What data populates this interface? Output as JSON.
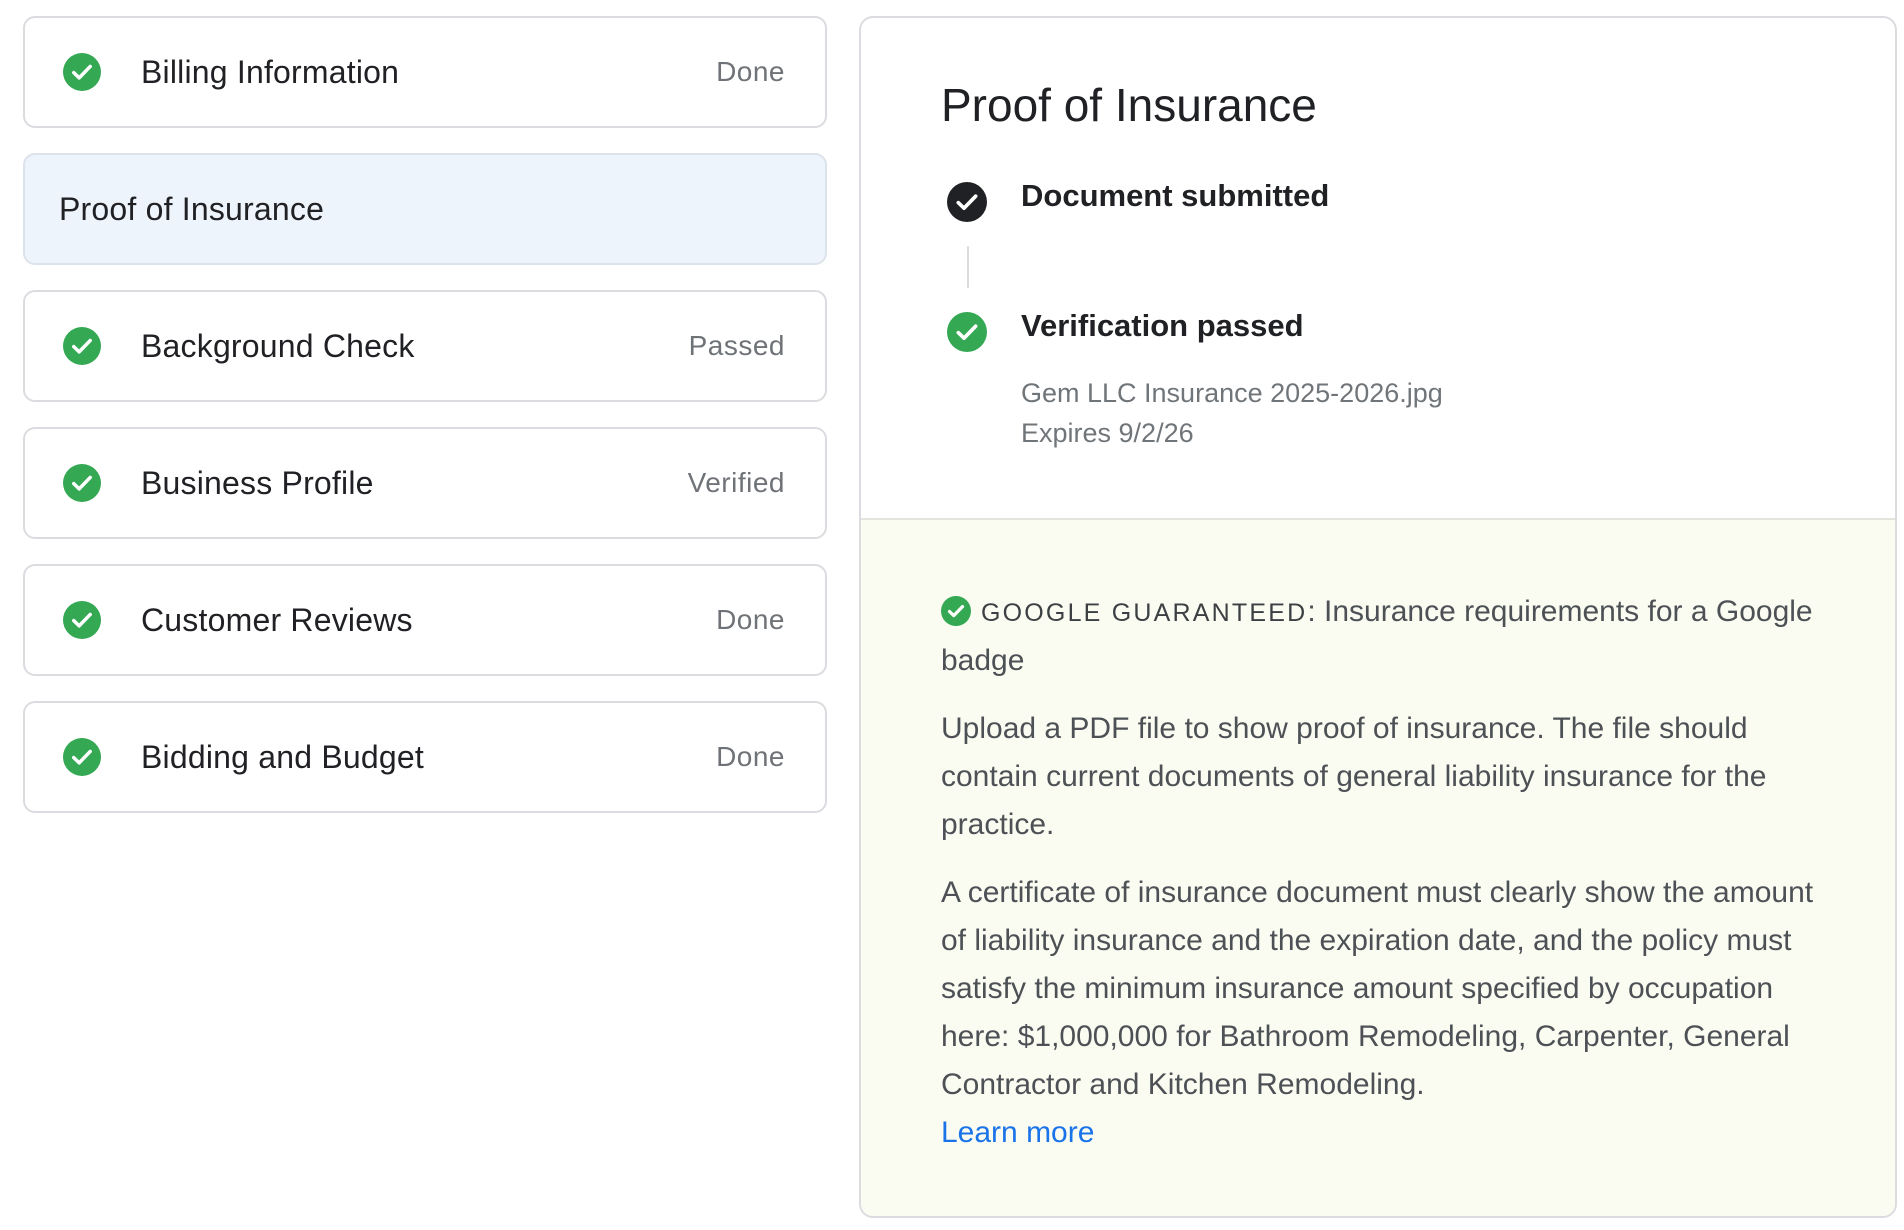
{
  "steps": [
    {
      "label": "Billing Information",
      "status": "Done"
    },
    {
      "label": "Proof of Insurance",
      "status": ""
    },
    {
      "label": "Background Check",
      "status": "Passed"
    },
    {
      "label": "Business Profile",
      "status": "Verified"
    },
    {
      "label": "Customer Reviews",
      "status": "Done"
    },
    {
      "label": "Bidding and Budget",
      "status": "Done"
    }
  ],
  "detail": {
    "title": "Proof of Insurance",
    "timeline": [
      {
        "label": "Document submitted"
      },
      {
        "label": "Verification passed"
      }
    ],
    "file_name": "Gem LLC Insurance 2025-2026.jpg",
    "expires": "Expires 9/2/26"
  },
  "guarantee": {
    "badge": "GOOGLE GUARANTEED",
    "separator": ":",
    "heading": " Insurance requirements for a Google badge",
    "para1": "Upload a PDF file to show proof of insurance. The file should contain current documents of general liability insurance for the practice.",
    "para2": "A certificate of insurance document must clearly show the amount of liability insurance and the expiration date, and the policy must satisfy the minimum insurance amount specified by occupation here: $1,000,000 for Bathroom Remodeling, Carpenter, General Contractor and Kitchen Remodeling.",
    "learn_more": "Learn more"
  },
  "colors": {
    "success_green": "#34a853",
    "dark_check": "#202124",
    "link_blue": "#1a73e8",
    "active_step_bg": "#eef4fb",
    "guarantee_bg": "#fafcf1"
  }
}
